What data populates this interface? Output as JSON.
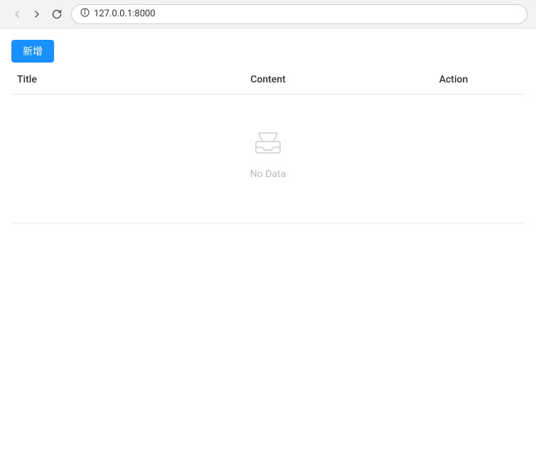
{
  "browser": {
    "url": "127.0.0.1:8000",
    "back_btn": "←",
    "forward_btn": "→",
    "reload_btn": "↻"
  },
  "toolbar": {
    "add_button_label": "新增"
  },
  "table": {
    "columns": [
      {
        "key": "title",
        "label": "Title"
      },
      {
        "key": "content",
        "label": "Content"
      },
      {
        "key": "action",
        "label": "Action"
      }
    ],
    "rows": [],
    "empty_text": "No Data"
  }
}
